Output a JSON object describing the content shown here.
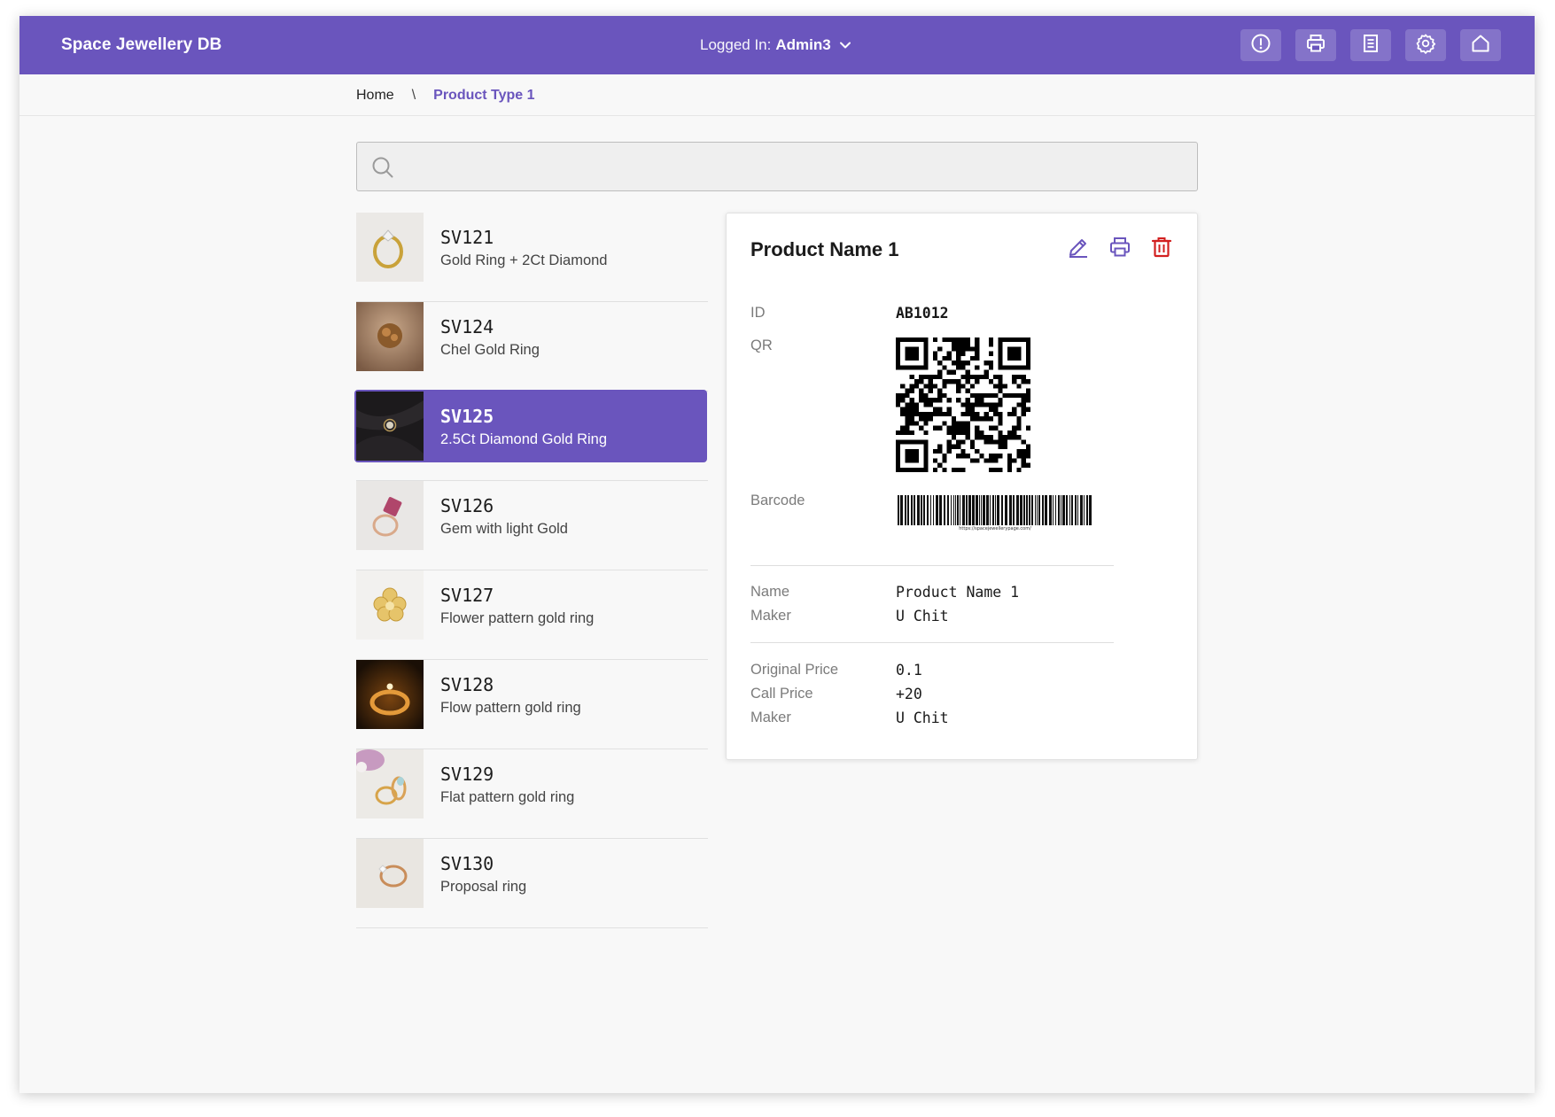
{
  "app": {
    "title": "Space Jewellery DB"
  },
  "user_menu": {
    "label": "Logged In:",
    "user": "Admin3"
  },
  "toolbar_icons": [
    "alert-icon",
    "print-icon",
    "document-icon",
    "settings-icon",
    "home-icon"
  ],
  "breadcrumb": {
    "home": "Home",
    "separator": "\\",
    "current": "Product Type 1"
  },
  "search": {
    "value": "",
    "placeholder": ""
  },
  "products": [
    {
      "code": "SV121",
      "description": "Gold Ring + 2Ct Diamond",
      "selected": false
    },
    {
      "code": "SV124",
      "description": "Chel Gold Ring",
      "selected": false
    },
    {
      "code": "SV125",
      "description": "2.5Ct Diamond Gold Ring",
      "selected": true
    },
    {
      "code": "SV126",
      "description": "Gem with light Gold",
      "selected": false
    },
    {
      "code": "SV127",
      "description": "Flower pattern gold ring",
      "selected": false
    },
    {
      "code": "SV128",
      "description": "Flow pattern gold ring",
      "selected": false
    },
    {
      "code": "SV129",
      "description": "Flat pattern gold ring",
      "selected": false
    },
    {
      "code": "SV130",
      "description": "Proposal ring",
      "selected": false
    }
  ],
  "detail": {
    "title": "Product Name 1",
    "actions": [
      "edit-icon",
      "print-icon",
      "delete-icon"
    ],
    "id_label": "ID",
    "id_value": "AB1012",
    "qr_label": "QR",
    "barcode_label": "Barcode",
    "barcode_text": "https://spacejewellerypage.com/",
    "name_label": "Name",
    "name_value": "Product Name 1",
    "maker_label": "Maker",
    "maker_value": "U Chit",
    "original_price_label": "Original Price",
    "original_price_value": "0.1",
    "call_price_label": "Call Price",
    "call_price_value": "+20",
    "maker2_label": "Maker",
    "maker2_value": "U Chit"
  },
  "colors": {
    "accent": "#6a55bd",
    "delete": "#d21f1f",
    "background": "#f8f8f8"
  }
}
